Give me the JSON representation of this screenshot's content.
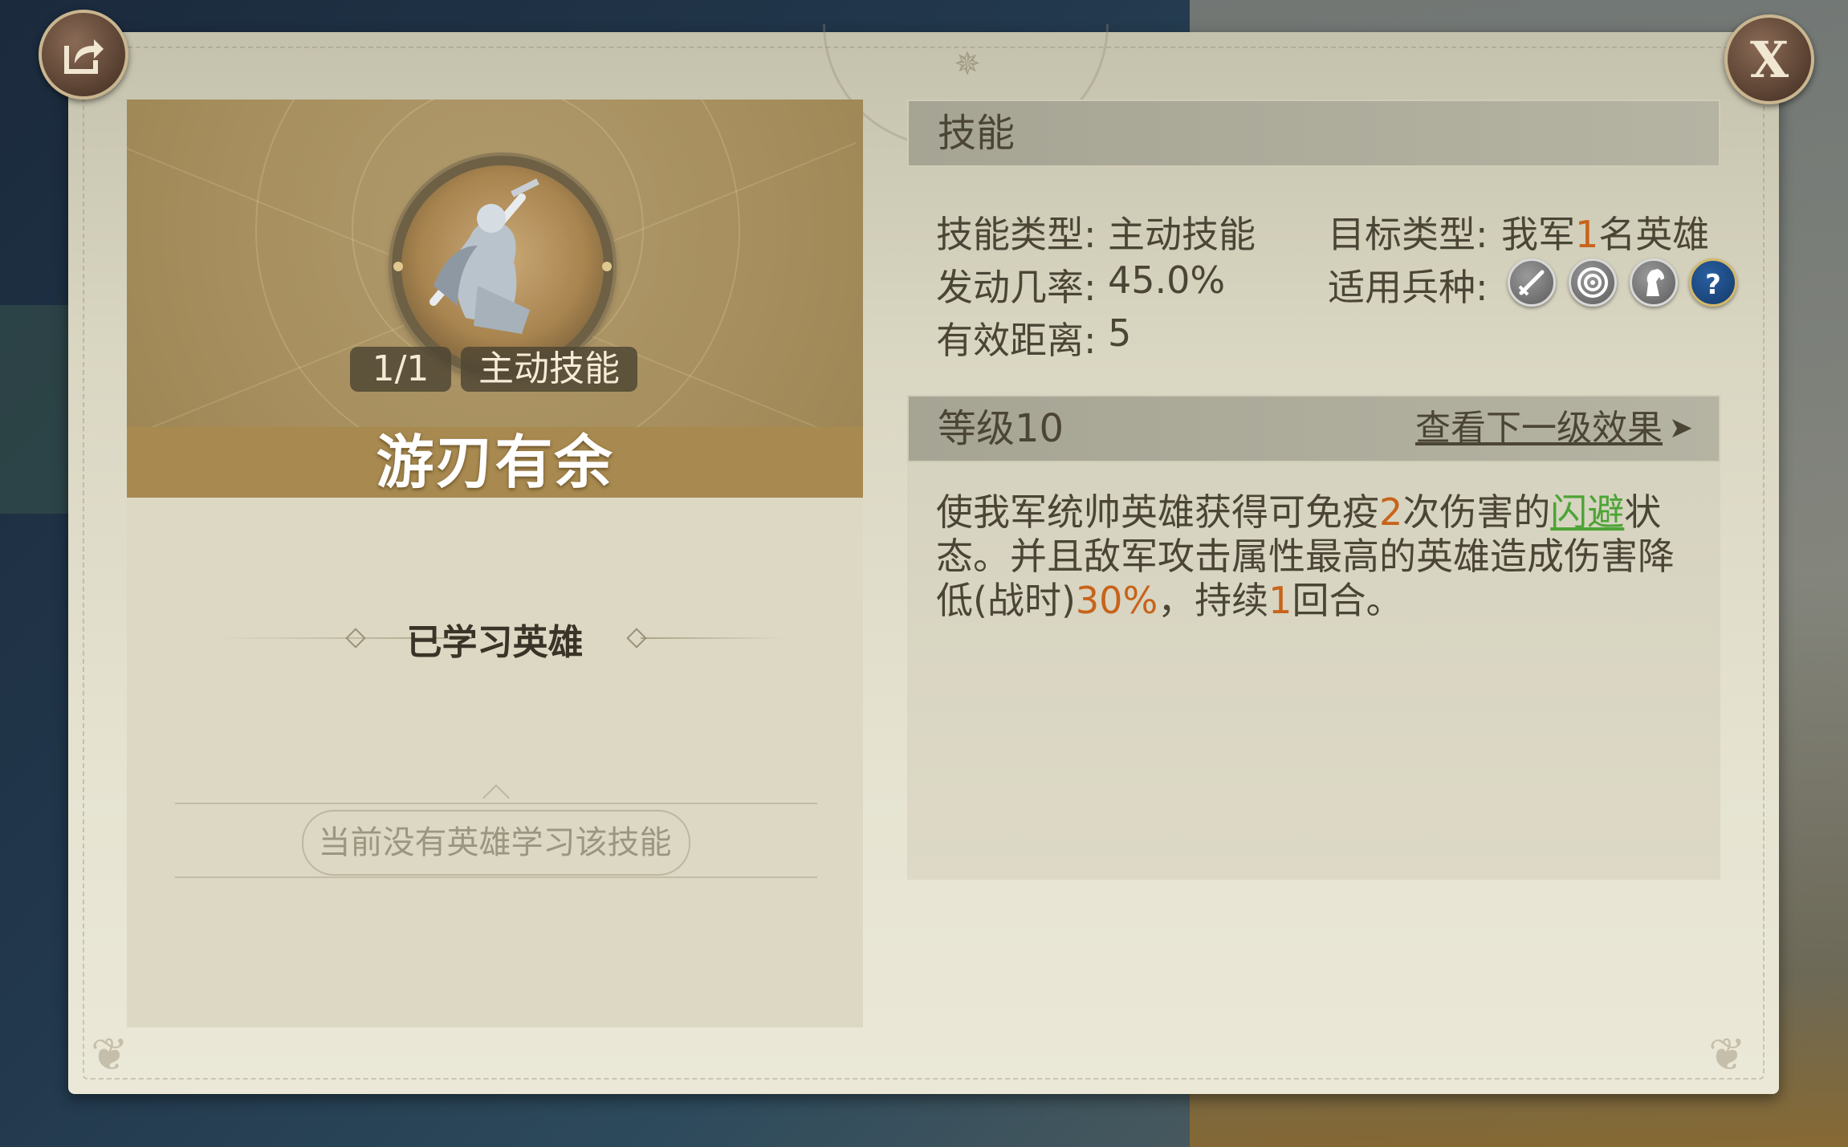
{
  "header": {
    "close_label": "X"
  },
  "icons": {
    "share": "share-icon",
    "close": "close-icon"
  },
  "skill": {
    "count": "1/1",
    "type_tag": "主动技能",
    "name": "游刃有余"
  },
  "learned": {
    "title": "已学习英雄",
    "empty_text": "当前没有英雄学习该技能"
  },
  "info": {
    "section_title": "技能",
    "skill_type_label": "技能类型:",
    "skill_type_value": "主动技能",
    "trigger_rate_label": "发动几率:",
    "trigger_rate_value": "45.0%",
    "range_label": "有效距离:",
    "range_value": "5",
    "target_label": "目标类型:",
    "target_prefix": "我军",
    "target_count": "1",
    "target_suffix": "名英雄",
    "troop_label": "适用兵种:",
    "troops": [
      "sword-icon",
      "target-icon",
      "horse-icon",
      "question-icon"
    ],
    "troop_help": "?"
  },
  "level": {
    "title": "等级10",
    "next_link": "查看下一级效果",
    "next_arrow": "➤"
  },
  "description": {
    "p1": "使我军统帅英雄获得可免疫",
    "n1": "2",
    "p2": "次伤害的",
    "status": "闪避",
    "p3": "状态。并且敌军攻击属性最高的英雄造成伤害降低(战时)",
    "n2": "30%",
    "p4": "，持续",
    "n3": "1",
    "p5": "回合。"
  },
  "colors": {
    "highlight_orange": "#c8631a",
    "highlight_green": "#4da436",
    "title_band": "#a88a50"
  }
}
